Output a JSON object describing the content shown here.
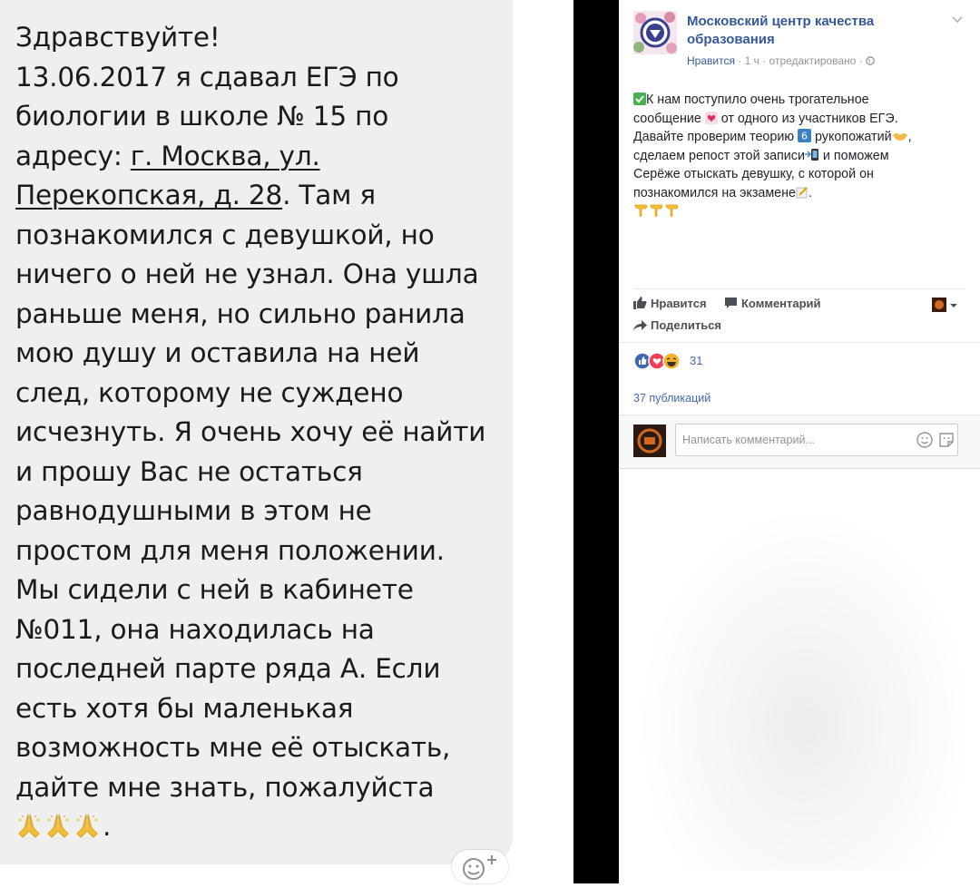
{
  "chat": {
    "greeting": "Здравствуйте!",
    "body_lines": [
      "13.06.2017 я сдавал ЕГЭ по",
      "биологии в школе № 15 по"
    ],
    "address_prefix": "адресу: ",
    "address_part1": "г. Москва, ул.",
    "address_part2": "Перекопская, д. 28",
    "after_address": ". Там я",
    "rest_lines": [
      "познакомился с девушкой, но",
      "ничего о ней не узнал. Она ушла",
      "раньше меня, но сильно ранила",
      "мою душу и оставила на ней",
      "след, которому не суждено",
      "исчезнуть. Я очень хочу её найти",
      "и прошу Вас не остаться",
      "равнодушными в этом не",
      "простом для меня положении.",
      "Мы сидели с ней в кабинете",
      "№011, она находилась на",
      "последней парте ряда А. Если",
      "есть хотя бы маленькая",
      "возможность мне её отыскать,",
      "дайте мне знать, пожалуйста"
    ],
    "final_punct": ".",
    "final_emoji": "folded-hands-icon x3",
    "bubble_color": "#efefef",
    "text_color": "#1a1a1a"
  },
  "post": {
    "page_name": "Московский центр качества образования",
    "meta_like": "Нравится",
    "meta_rest": " · 1 ч · отредактировано · ",
    "text_lines": [
      "К нам поступило очень трогательное",
      "сообщение",
      "от одного из участников ЕГЭ.",
      "Давайте проверим теорию",
      "рукопожатий",
      "сделаем репост этой записи",
      "и поможем",
      "Серёже отыскать девушку, с которой он",
      "познакомился на экзамене",
      "."
    ],
    "like_action": "Нравится",
    "comment_action": "Комментарий",
    "share_action": "Поделиться",
    "reaction_count": "31",
    "shares_text": "37 публикаций",
    "comment_placeholder": "Написать комментарий...",
    "link_color": "#365899",
    "text_color": "#1d2129"
  }
}
